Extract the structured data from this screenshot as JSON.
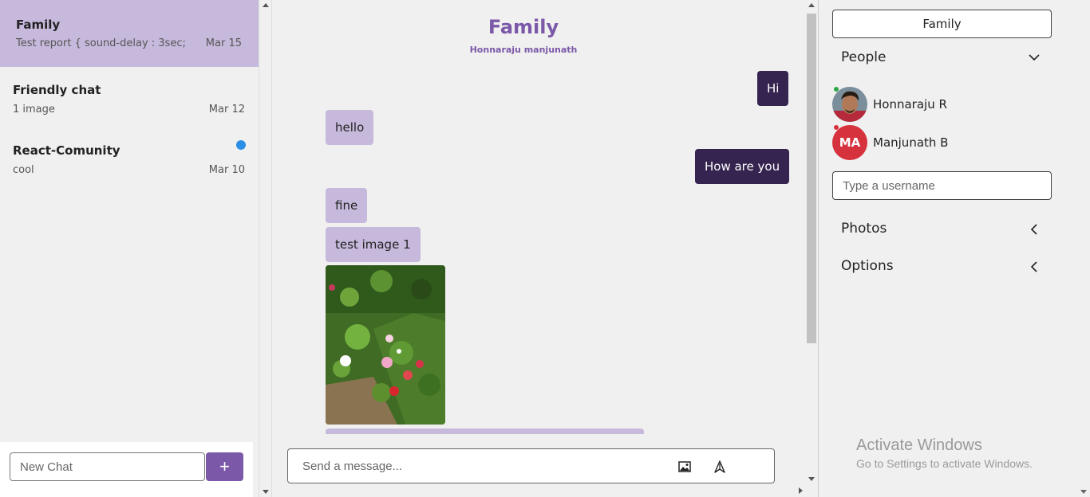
{
  "chats": [
    {
      "title": "Family",
      "preview": "Test report { sound-delay : 3sec;",
      "date": "Mar 15",
      "active": true,
      "unread": false
    },
    {
      "title": "Friendly chat",
      "preview": "1 image",
      "date": "Mar 12",
      "active": false,
      "unread": false
    },
    {
      "title": "React-Comunity",
      "preview": "cool",
      "date": "Mar 10",
      "active": false,
      "unread": true
    }
  ],
  "new_chat": {
    "placeholder": "New Chat",
    "button_label": "+"
  },
  "conversation": {
    "title": "Family",
    "subtitle": "Honnaraju manjunath",
    "messages": [
      {
        "text": "Hi",
        "mine": true
      },
      {
        "text": "hello",
        "mine": false
      },
      {
        "text": "How are you",
        "mine": true
      },
      {
        "text": "fine",
        "mine": false
      },
      {
        "text": "test image 1",
        "mine": false
      }
    ],
    "image_message": "flower-photo"
  },
  "composer": {
    "placeholder": "Send a message...",
    "image_icon": "image-icon",
    "send_icon": "send-icon"
  },
  "settings": {
    "chat_name": "Family",
    "people_label": "People",
    "people": [
      {
        "name": "Honnaraju R",
        "avatar": "photo",
        "online": true
      },
      {
        "name": "Manjunath B",
        "initials": "MA",
        "online": false
      }
    ],
    "username_placeholder": "Type a username",
    "photos_label": "Photos",
    "options_label": "Options"
  },
  "watermark": {
    "title": "Activate Windows",
    "subtitle": "Go to Settings to activate Windows."
  },
  "colors": {
    "accent": "#7b58a8",
    "bubble_mine": "#35244f",
    "bubble_theirs": "#c7b9dc",
    "unread_dot": "#2b8fe6",
    "avatar_red": "#d6323d"
  }
}
